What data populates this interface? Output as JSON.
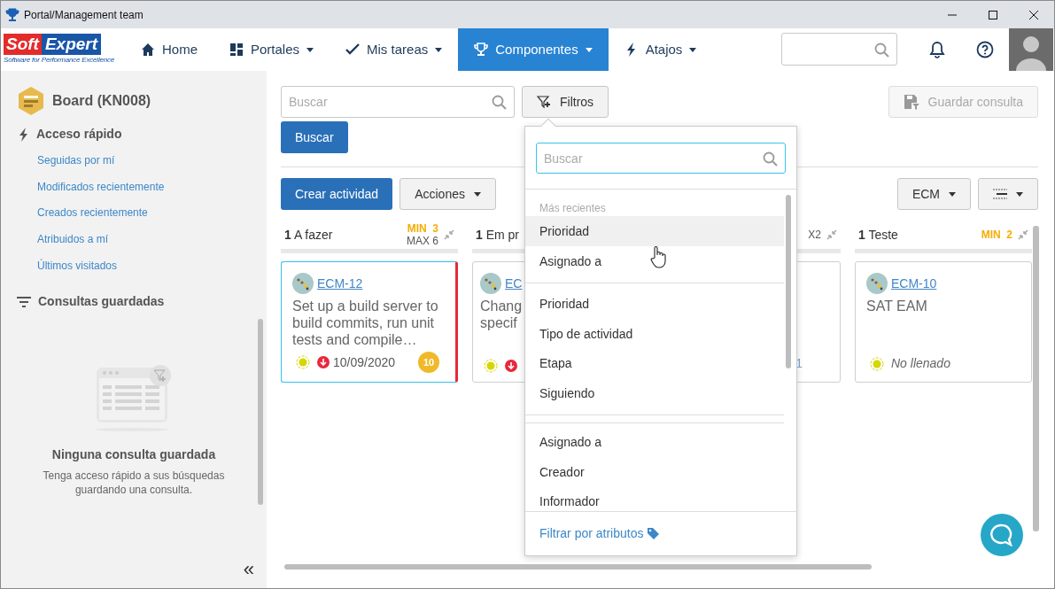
{
  "window": {
    "title": "Portal/Management team"
  },
  "logo": {
    "word_1": "Soft",
    "word_2": "Expert",
    "tagline": "Software for Performance Excellence"
  },
  "nav": [
    {
      "label": "Home",
      "dropdown": false,
      "selected": false
    },
    {
      "label": "Portales",
      "dropdown": true,
      "selected": false
    },
    {
      "label": "Mis tareas",
      "dropdown": true,
      "selected": false
    },
    {
      "label": "Componentes",
      "dropdown": true,
      "selected": true
    },
    {
      "label": "Atajos",
      "dropdown": true,
      "selected": false
    }
  ],
  "sidebar": {
    "title": "Board (KN008)",
    "quick_access": {
      "heading": "Acceso rápido",
      "links": [
        "Seguidas por mí",
        "Modificados recientemente",
        "Creados recientemente",
        "Atribuidos a mí",
        "Últimos visitados"
      ]
    },
    "saved": {
      "heading": "Consultas guardadas",
      "empty_title": "Ninguna consulta guardada",
      "empty_text": "Tenga acceso rápido a sus búsquedas guardando una consulta."
    },
    "collapse": "«"
  },
  "toolbar": {
    "search": {
      "placeholder": "Buscar"
    },
    "filter_button": "Filtros",
    "save_button": {
      "label": "Guardar consulta",
      "disabled": true
    },
    "search_button": "Buscar",
    "create_button": "Crear actividad",
    "actions_button": "Acciones",
    "type_button": "ECM"
  },
  "columns": [
    {
      "count": "1",
      "title": "A fazer",
      "min_label": "MIN",
      "min": "3",
      "max_label": "MAX",
      "max": "6",
      "cards": [
        {
          "id": "ECM-12",
          "title": "Set up a build server to build commits, run unit tests and compile…",
          "date": "10/09/2020",
          "badge": "10",
          "selected": true,
          "color": "#e8283c"
        }
      ]
    },
    {
      "count": "1",
      "title": "Em pr",
      "cards": [
        {
          "id": "EC",
          "title": "Chang\nspecif",
          "selected": false
        }
      ]
    },
    {
      "header_tail": "X2",
      "cards": [
        {
          "footer_tail": "1",
          "selected": false
        }
      ]
    },
    {
      "count": "1",
      "title": "Teste",
      "min_label": "MIN",
      "min": "2",
      "cards": [
        {
          "id": "ECM-10",
          "title": "SAT EAM",
          "status_text": "No llenado",
          "selected": false
        }
      ]
    }
  ],
  "filter_menu": {
    "search": {
      "placeholder": "Buscar"
    },
    "recent_heading": "Más recientes",
    "recent": [
      {
        "label": "Prioridad",
        "highlighted": true
      },
      {
        "label": "Asignado a",
        "highlighted": false
      }
    ],
    "groups": [
      [
        "Prioridad",
        "Tipo de actividad",
        "Etapa",
        "Siguiendo"
      ],
      [
        "Asignado a",
        "Creador",
        "Informador"
      ]
    ],
    "footer_link": "Filtrar por atributos"
  }
}
